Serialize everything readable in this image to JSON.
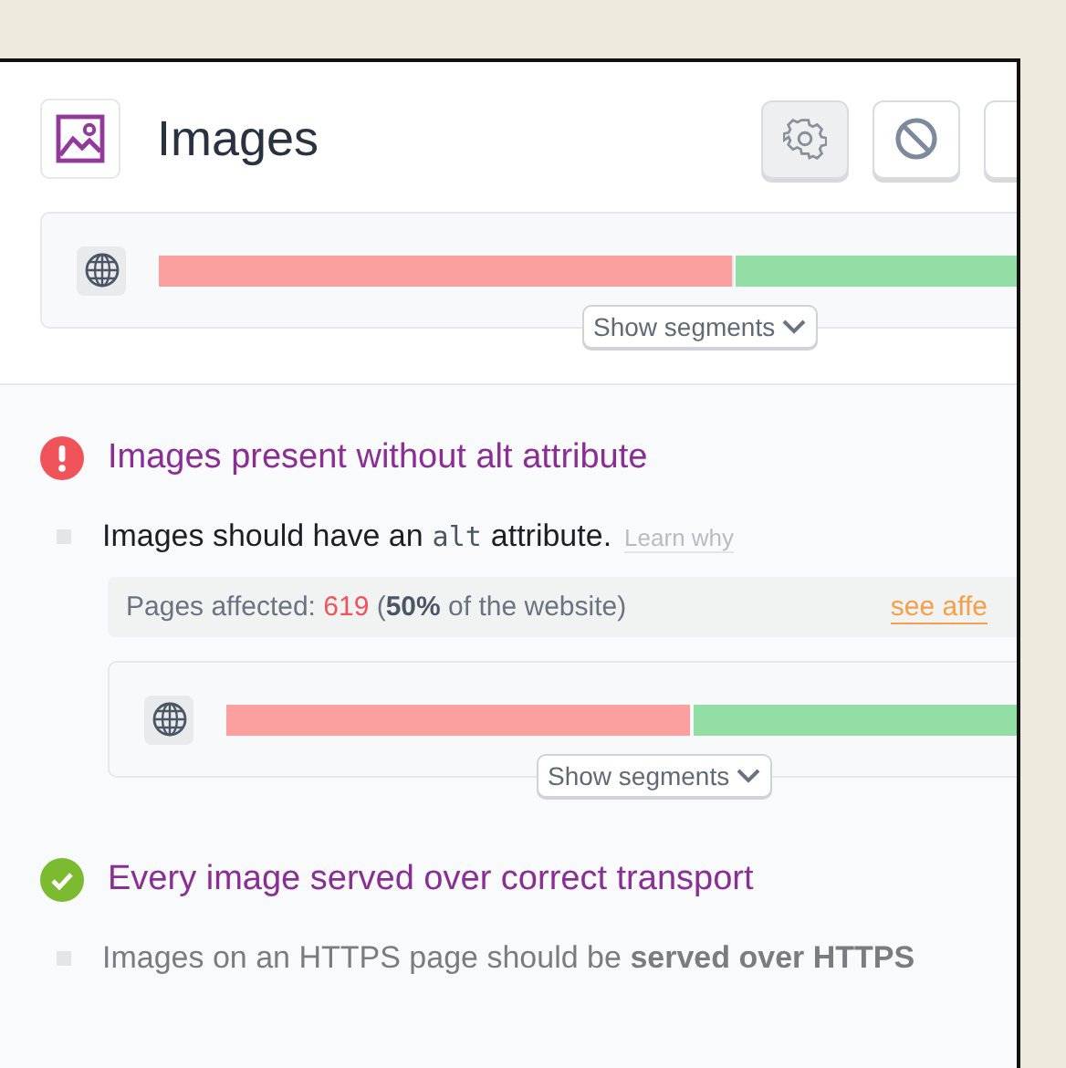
{
  "header": {
    "title": "Images",
    "buttons": [
      {
        "kind": "settings",
        "pressed": true
      },
      {
        "kind": "block",
        "pressed": false
      },
      {
        "kind": "blank",
        "pressed": false
      }
    ],
    "chart": {
      "level": 0.5,
      "toggle": "Show segments"
    }
  },
  "issues": [
    {
      "kind": "fail",
      "title": "Images present without alt attribute",
      "description": {
        "before": "Images should have an",
        "code": "alt",
        "after": "attribute."
      },
      "learn_link": "Learn why",
      "affected": {
        "label": "Pages affected:",
        "count": "619",
        "share": "(**50%** of the website)",
        "link": "see affe"
      },
      "chart": {
        "level": 0.5,
        "toggle": "Show segments"
      }
    },
    {
      "kind": "pass",
      "title": "Every image served over correct transport",
      "description": {
        "before": "Images on an HTTPS page should be **served over HTTPS**"
      }
    }
  ]
}
